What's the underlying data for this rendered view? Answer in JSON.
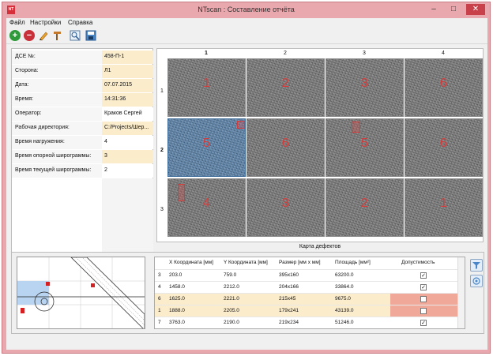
{
  "window": {
    "title": "NTscan : Составление отчёта",
    "app_icon_text": "NT"
  },
  "menu": [
    "Файл",
    "Настройки",
    "Справка"
  ],
  "toolbar": {
    "icons": [
      "add-icon",
      "remove-icon",
      "pencil-icon",
      "hammer-icon",
      "image-search-icon",
      "save-icon"
    ]
  },
  "form": [
    {
      "label": "ДСЕ №:",
      "value": "458-П-1"
    },
    {
      "label": "Сторона:",
      "value": "Л1"
    },
    {
      "label": "Дата:",
      "value": "07.07.2015"
    },
    {
      "label": "Время:",
      "value": "14:31:36"
    },
    {
      "label": "Оператор:",
      "value": "Краков Сергей"
    },
    {
      "label": "Рабочая директория:",
      "value": "C:/Projects/Шер..."
    },
    {
      "label": "Время нагружения:",
      "value": "4"
    },
    {
      "label": "Время опорной широграммы:",
      "value": "3"
    },
    {
      "label": "Время текущей широграммы:",
      "value": "2"
    }
  ],
  "grid": {
    "columns": [
      "1",
      "2",
      "3",
      "4"
    ],
    "rows": [
      "1",
      "2",
      "3"
    ],
    "cells": [
      [
        "1",
        "2",
        "3",
        "6"
      ],
      [
        "5",
        "6",
        "5",
        "6"
      ],
      [
        "4",
        "3",
        "2",
        "1"
      ]
    ],
    "selected": "row 2, column 1"
  },
  "map_label": "Карта дефектов",
  "defect_table": {
    "headers": [
      "X Координата [мм]",
      "Y Координата [мм]",
      "Размер [мм x мм]",
      "Площадь [мм²]",
      "Допустимость"
    ],
    "rows": [
      {
        "id": "3",
        "x": "203.0",
        "y": "759.0",
        "size": "395x160",
        "area": "63200.0",
        "ok": true
      },
      {
        "id": "4",
        "x": "1458.0",
        "y": "2212.0",
        "size": "204x166",
        "area": "33864.0",
        "ok": true
      },
      {
        "id": "6",
        "x": "1625.0",
        "y": "2221.0",
        "size": "215x45",
        "area": "9675.0",
        "ok": false
      },
      {
        "id": "1",
        "x": "1888.0",
        "y": "2205.0",
        "size": "179x241",
        "area": "43139.0",
        "ok": false
      },
      {
        "id": "7",
        "x": "3763.0",
        "y": "2190.0",
        "size": "219x234",
        "area": "51246.0",
        "ok": true
      }
    ]
  },
  "colors": {
    "title_bar": "#e9a8ad",
    "selected_cell": "#5f86ad",
    "row_highlight": "#fbeccb",
    "reject": "#f0a898",
    "marker": "#d43c3c"
  },
  "side_icons": [
    "filter-icon",
    "view-icon"
  ]
}
